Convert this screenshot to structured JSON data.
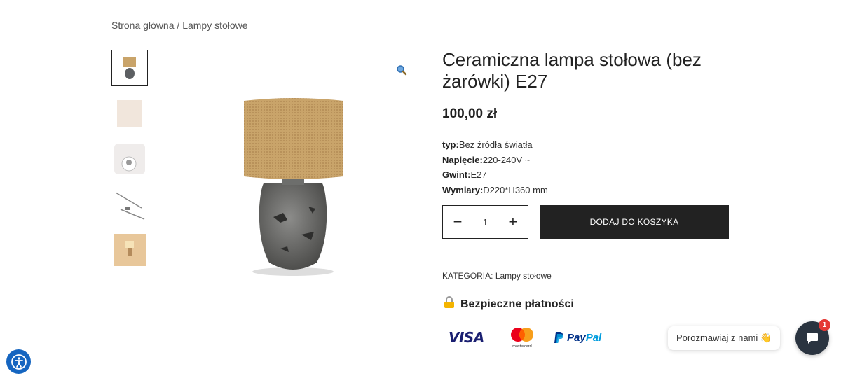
{
  "breadcrumb": {
    "home": "Strona główna",
    "separator": " / ",
    "current": "Lampy stołowe"
  },
  "gallery": {
    "thumbnails": [
      "lamp-front",
      "lamp-shade",
      "lamp-bulb-socket",
      "lamp-cable",
      "lamp-lit"
    ]
  },
  "product": {
    "title": "Ceramiczna lampa stołowa (bez żarówki) E27",
    "price": "100,00 zł",
    "specs": [
      {
        "label": "typ:",
        "value": "Bez źródła światła"
      },
      {
        "label": "Napięcie:",
        "value": "220-240V ~"
      },
      {
        "label": "Gwint:",
        "value": "E27"
      },
      {
        "label": "Wymiary:",
        "value": "D220*H360 mm"
      }
    ],
    "quantity": "1",
    "minus": "−",
    "plus": "+",
    "add_to_cart": "DODAJ DO KOSZYKA",
    "category_label": "KATEGORIA:",
    "category_value": "Lampy stołowe"
  },
  "secure": {
    "label": "Bezpieczne płatności",
    "icon": "lock-icon"
  },
  "payments": {
    "visa": "VISA",
    "mastercard": "mastercard",
    "paypal_a": "Pay",
    "paypal_b": "Pal"
  },
  "chat": {
    "prompt": "Porozmawiaj z nami 👋",
    "badge": "1"
  },
  "colors": {
    "primary": "#222222",
    "accessibility": "#1565c0",
    "chat": "#2a3440",
    "badge": "#e53935"
  }
}
